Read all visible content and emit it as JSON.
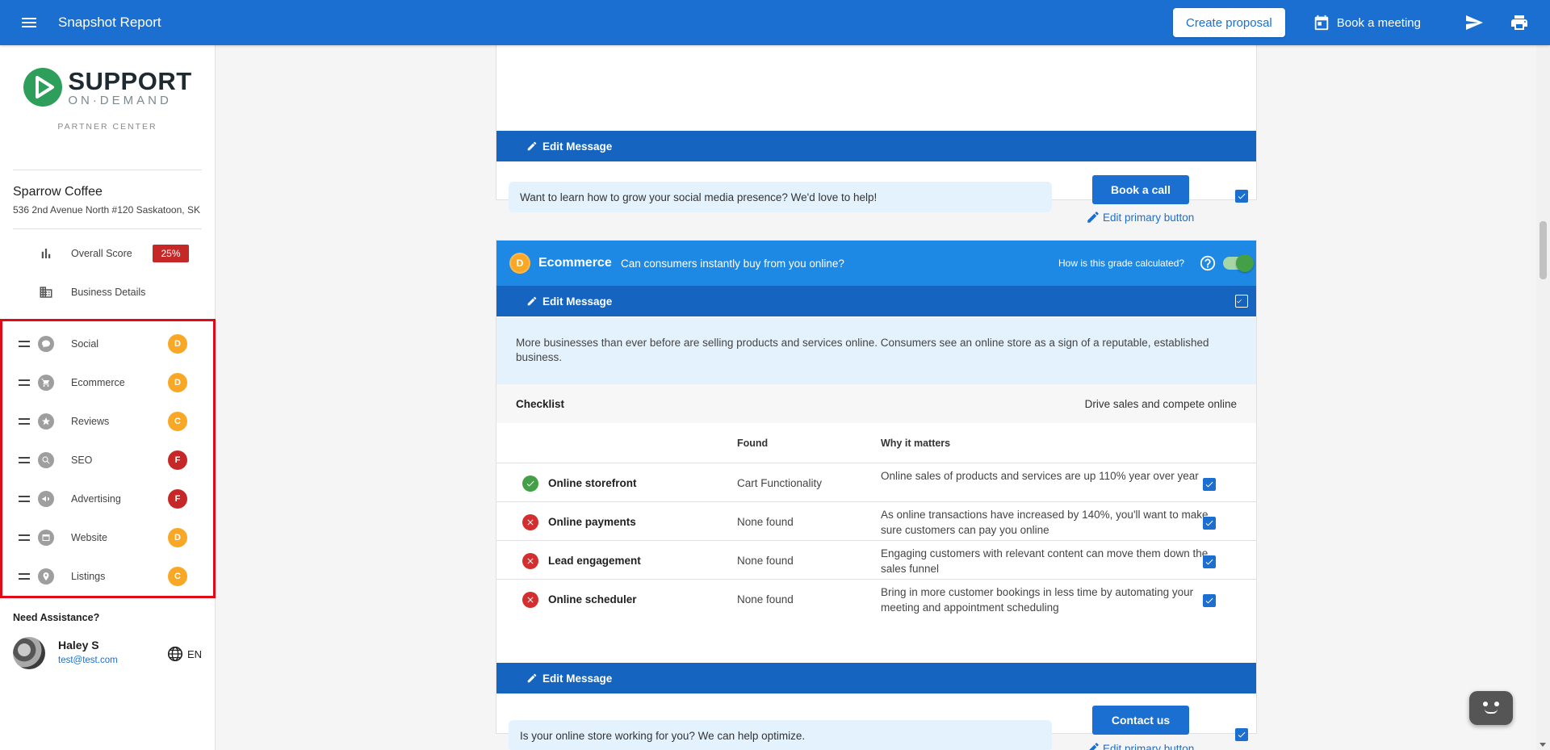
{
  "topbar": {
    "title": "Snapshot Report",
    "create_proposal": "Create proposal",
    "book_meeting": "Book a meeting"
  },
  "sidebar": {
    "logo_big": "SUPPORT",
    "logo_small": "ON·DEMAND",
    "partner_center": "PARTNER CENTER",
    "business_name": "Sparrow Coffee",
    "business_address": "536 2nd Avenue North #120 Saskatoon, SK",
    "overall_score_label": "Overall Score",
    "overall_score_value": "25%",
    "business_details_label": "Business Details",
    "sections": [
      {
        "label": "Social",
        "grade": "D",
        "icon": "chat-bubble-icon",
        "color": "#f9a825"
      },
      {
        "label": "Ecommerce",
        "grade": "D",
        "icon": "cart-icon",
        "color": "#f9a825"
      },
      {
        "label": "Reviews",
        "grade": "C",
        "icon": "star-icon",
        "color": "#f9a825"
      },
      {
        "label": "SEO",
        "grade": "F",
        "icon": "search-icon",
        "color": "#c62828"
      },
      {
        "label": "Advertising",
        "grade": "F",
        "icon": "megaphone-icon",
        "color": "#c62828"
      },
      {
        "label": "Website",
        "grade": "D",
        "icon": "browser-icon",
        "color": "#f9a825"
      },
      {
        "label": "Listings",
        "grade": "C",
        "icon": "location-pin-icon",
        "color": "#f9a825"
      }
    ],
    "need_assistance": "Need Assistance?",
    "contact_name": "Haley S",
    "contact_email": "test@test.com",
    "language": "EN"
  },
  "social_card": {
    "edit_message": "Edit Message",
    "message": "Want to learn how to grow your social media presence? We'd love to help!",
    "primary_button": "Book a call",
    "edit_primary": "Edit primary button"
  },
  "ecommerce_card": {
    "grade": "D",
    "title": "Ecommerce",
    "subtitle": "Can consumers instantly buy from you online?",
    "grade_question": "How is this grade calculated?",
    "edit_message": "Edit Message",
    "description": "More businesses than ever before are selling products and services online. Consumers see an online store as a sign of a reputable, established business.",
    "checklist_title": "Checklist",
    "checklist_subtitle": "Drive sales and compete online",
    "col_found": "Found",
    "col_why": "Why it matters",
    "rows": [
      {
        "name": "Online storefront",
        "found": "Cart Functionality",
        "why": "Online sales of products and services are up 110% year over year",
        "status": "pass"
      },
      {
        "name": "Online payments",
        "found": "None found",
        "why": "As online transactions have increased by 140%, you'll want to make sure customers can pay you online",
        "status": "fail"
      },
      {
        "name": "Lead engagement",
        "found": "None found",
        "why": "Engaging customers with relevant content can move them down the sales funnel",
        "status": "fail"
      },
      {
        "name": "Online scheduler",
        "found": "None found",
        "why": "Bring in more customer bookings in less time by automating your meeting and appointment scheduling",
        "status": "fail"
      }
    ],
    "edit_message_bottom": "Edit Message",
    "message": "Is your online store working for you? We can help optimize.",
    "primary_button": "Contact us",
    "edit_primary": "Edit primary button"
  },
  "colors": {
    "topbar": "#1a6fd1",
    "pass": "#43a047",
    "fail": "#d32f2f"
  }
}
